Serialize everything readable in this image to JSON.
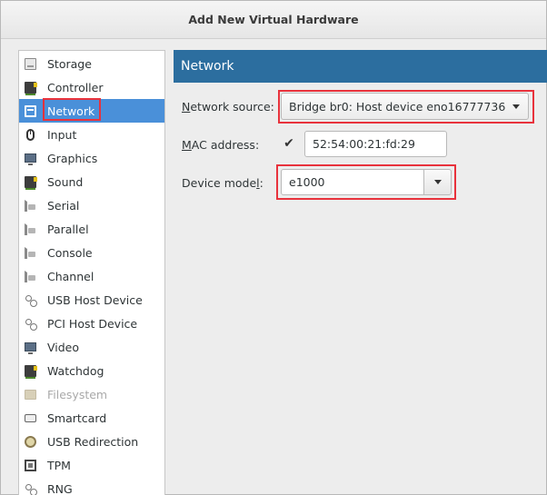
{
  "window": {
    "title": "Add New Virtual Hardware"
  },
  "sidebar": {
    "items": [
      {
        "label": "Storage",
        "icon": "storage-icon"
      },
      {
        "label": "Controller",
        "icon": "controller-icon"
      },
      {
        "label": "Network",
        "icon": "network-icon",
        "selected": true
      },
      {
        "label": "Input",
        "icon": "mouse-icon"
      },
      {
        "label": "Graphics",
        "icon": "monitor-icon"
      },
      {
        "label": "Sound",
        "icon": "sound-card-icon"
      },
      {
        "label": "Serial",
        "icon": "serial-port-icon"
      },
      {
        "label": "Parallel",
        "icon": "parallel-port-icon"
      },
      {
        "label": "Console",
        "icon": "console-port-icon"
      },
      {
        "label": "Channel",
        "icon": "channel-port-icon"
      },
      {
        "label": "USB Host Device",
        "icon": "usb-icon"
      },
      {
        "label": "PCI Host Device",
        "icon": "pci-icon"
      },
      {
        "label": "Video",
        "icon": "video-icon"
      },
      {
        "label": "Watchdog",
        "icon": "watchdog-icon"
      },
      {
        "label": "Filesystem",
        "icon": "folder-icon",
        "disabled": true
      },
      {
        "label": "Smartcard",
        "icon": "smartcard-icon"
      },
      {
        "label": "USB Redirection",
        "icon": "usb-redirection-icon"
      },
      {
        "label": "TPM",
        "icon": "tpm-icon"
      },
      {
        "label": "RNG",
        "icon": "rng-icon"
      }
    ]
  },
  "panel": {
    "header": "Network",
    "network_source": {
      "label_mnemonic": "N",
      "label_rest": "etwork source:",
      "value": "Bridge br0: Host device eno16777736"
    },
    "mac_address": {
      "label_mnemonic": "M",
      "label_rest": "AC address:",
      "checkbox_symbol": "✔",
      "checked": true,
      "value": "52:54:00:21:fd:29"
    },
    "device_model": {
      "label_prefix": "Device mode",
      "label_mnemonic": "l",
      "label_suffix": ":",
      "value": "e1000"
    }
  },
  "colors": {
    "selection": "#4a90d9",
    "panel_header": "#2c6e9f",
    "highlight_box": "#e8323c"
  }
}
